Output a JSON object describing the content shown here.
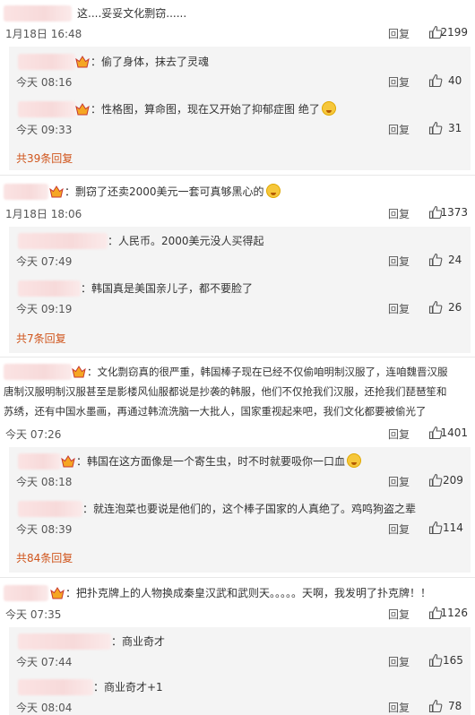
{
  "actions": {
    "reply": "回复"
  },
  "colors": {
    "more_link": "#d0551c",
    "thread_bg": "#f4f4f4",
    "name_blur": "#f7dada"
  },
  "icons": {
    "like": "thumb-up-icon",
    "badge": "member-badge-icon",
    "emoji": "emoji-icon"
  },
  "threads": [
    {
      "text": "这....妥妥文化剽窃......",
      "time": "1月18日 16:48",
      "likes": "2199",
      "replies": [
        {
          "text": "：偷了身体，抹去了灵魂",
          "time": "今天 08:16",
          "likes": "40"
        },
        {
          "text": "：性格图，算命图，现在又开始了抑郁症图 绝了",
          "time": "今天 09:33",
          "likes": "31"
        }
      ],
      "more": "共39条回复"
    },
    {
      "text": "：剽窃了还卖2000美元一套可真够黑心的",
      "time": "1月18日 18:06",
      "likes": "1373",
      "replies": [
        {
          "text": "：人民币。2000美元没人买得起",
          "time": "今天 07:49",
          "likes": "24"
        },
        {
          "text": "：韩国真是美国亲儿子，都不要脸了",
          "time": "今天 09:19",
          "likes": "26"
        }
      ],
      "more": "共7条回复"
    },
    {
      "text_lines": [
        "：文化剽窃真的很严重，韩国棒子现在已经不仅偷咱明制汉服了，连咱魏晋汉服",
        "唐制汉服明制汉服甚至是影楼风仙服都说是抄袭的韩服，他们不仅抢我们汉服，还抢我们琵琶笙和",
        "苏绣，还有中国水墨画，再通过韩流洗脑一大批人，国家重视起来吧，我们文化都要被偷光了"
      ],
      "time": "今天 07:26",
      "likes": "1401",
      "replies": [
        {
          "text": "：韩国在这方面像是一个寄生虫，时不时就要吸你一口血",
          "time": "今天 08:18",
          "likes": "209"
        },
        {
          "text": "：就连泡菜也要说是他们的，这个棒子国家的人真绝了。鸡鸣狗盗之辈",
          "time": "今天 08:39",
          "likes": "114"
        }
      ],
      "more": "共84条回复"
    },
    {
      "text": "：把扑克牌上的人物换成秦皇汉武和武则天。。。。。天啊，我发明了扑克牌！！",
      "time": "今天 07:35",
      "likes": "1126",
      "replies": [
        {
          "text": "：商业奇才",
          "time": "今天 07:44",
          "likes": "165"
        },
        {
          "text": "：商业奇才+1",
          "time": "今天 08:04",
          "likes": "78"
        }
      ]
    }
  ]
}
